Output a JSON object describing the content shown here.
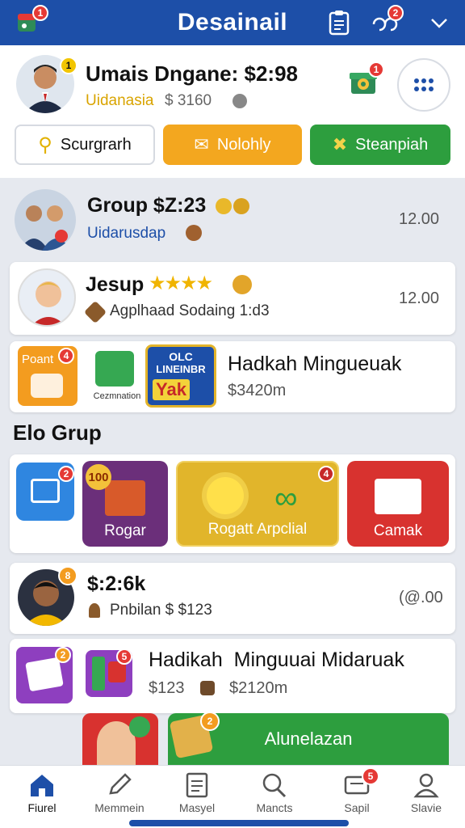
{
  "app": {
    "title": "Desainail"
  },
  "topbar": {
    "left_badge": "1",
    "chat_badge": "2"
  },
  "profile": {
    "name": "Umais Dngane: $2:98",
    "subtitle": "Uidanasia",
    "amount": "$ 3160",
    "avatar_badge": "1",
    "gift_badge": "1",
    "buttons": [
      {
        "label": "Scurgrarh"
      },
      {
        "label": "Nolohly"
      },
      {
        "label": "Steanpiah"
      }
    ]
  },
  "group": {
    "title": "Group $Z:23",
    "subtitle": "Uidarusdap",
    "value": "12.00"
  },
  "jesup": {
    "title": "Jesup",
    "subtitle": "Agplhaad Sodaing 1:d3",
    "value": "12.00"
  },
  "hadkah": {
    "tile1_label": "Poant",
    "tile1_badge": "4",
    "tile2_label": "Cezmnation",
    "tile3_lines": [
      "OLC",
      "LINEINBR",
      "Yak"
    ],
    "title": "Hadkah Mingueuak",
    "subtitle": "$3420m"
  },
  "section": {
    "title": "Elo Grup"
  },
  "grid_tiles": [
    {
      "label": "",
      "badge": "2",
      "color": "#2f86e0"
    },
    {
      "label": "Rogar",
      "badge": "100",
      "color": "#6b2f7a"
    },
    {
      "label": "Rogatt Arpclial",
      "badge": "4",
      "color": "#e1b52b"
    },
    {
      "label": "Camak",
      "badge": "",
      "color": "#d8322f"
    }
  ],
  "person2": {
    "title": "$:2:6k",
    "subtitle": "Pnbilan $ $123",
    "value": "(@.00",
    "badge": "8"
  },
  "hadikah2": {
    "title": "Hadikah  Minguuai Midaruak",
    "subtitle_a": "$123",
    "subtitle_b": "$2120m",
    "badge1": "2",
    "badge2": "5"
  },
  "promo": {
    "label": "Alunelazan",
    "badge": "2"
  },
  "bottom_nav": [
    {
      "label": "Fiurel",
      "icon": "home-icon"
    },
    {
      "label": "Memmein",
      "icon": "pencil-icon"
    },
    {
      "label": "Masyel",
      "icon": "document-icon"
    },
    {
      "label": "Mancts",
      "icon": "search-icon"
    },
    {
      "label": "Sapil",
      "icon": "message-icon",
      "badge": "5"
    },
    {
      "label": "Slavie",
      "icon": "profile-icon"
    }
  ],
  "colors": {
    "header": "#1d4fa8",
    "orange": "#f3a71f",
    "green": "#2d9e3e"
  }
}
